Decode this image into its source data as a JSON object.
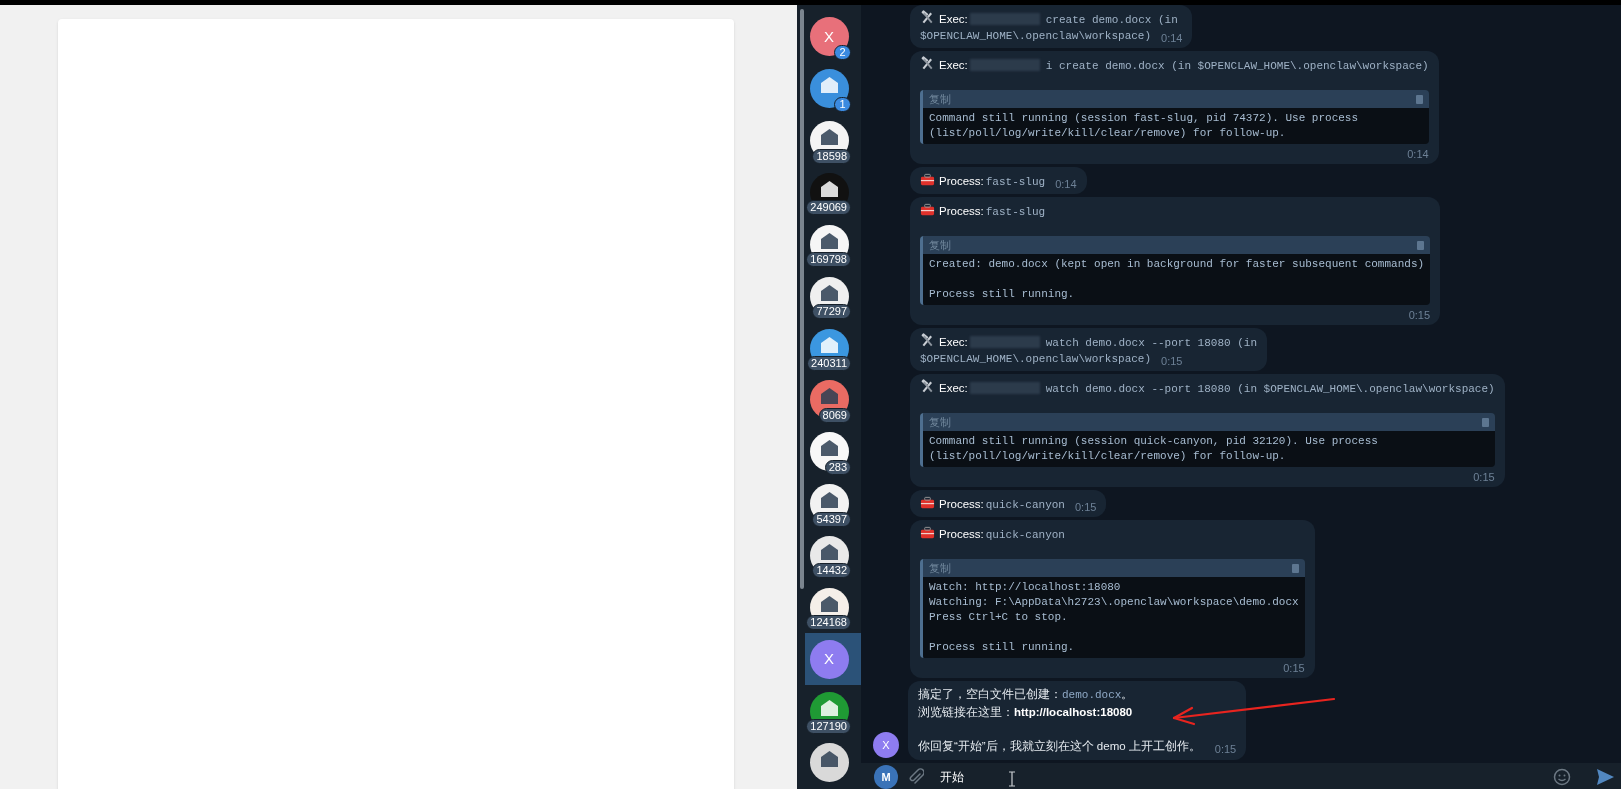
{
  "chats": [
    {
      "kind": "initial",
      "initial": "X",
      "color": "#e8707a",
      "badge": "2",
      "muted": false,
      "selected": false
    },
    {
      "kind": "picture",
      "color": "#3a8fdc",
      "badge": "1",
      "muted": false,
      "selected": false
    },
    {
      "kind": "picture",
      "color": "#f4f4f4",
      "badge": "18598",
      "muted": true,
      "selected": false
    },
    {
      "kind": "picture",
      "color": "#111111",
      "badge": "249069",
      "muted": true,
      "selected": false
    },
    {
      "kind": "picture",
      "color": "#f6f6f6",
      "badge": "169798",
      "muted": true,
      "selected": false
    },
    {
      "kind": "picture",
      "color": "#efefef",
      "badge": "77297",
      "muted": true,
      "selected": false
    },
    {
      "kind": "picture",
      "color": "#3b97e0",
      "badge": "240311",
      "muted": true,
      "selected": false
    },
    {
      "kind": "picture",
      "color": "#ea6b63",
      "badge": "8069",
      "muted": true,
      "selected": false
    },
    {
      "kind": "picture",
      "color": "#f8f8f8",
      "badge": "283",
      "muted": true,
      "selected": false
    },
    {
      "kind": "picture",
      "color": "#f2f2f2",
      "badge": "54397",
      "muted": true,
      "selected": false
    },
    {
      "kind": "picture",
      "color": "#e9e9e9",
      "badge": "14432",
      "muted": true,
      "selected": false
    },
    {
      "kind": "picture",
      "color": "#f5efe9",
      "badge": "124168",
      "muted": true,
      "selected": false
    },
    {
      "kind": "initial",
      "initial": "X",
      "color": "#8e7cf0",
      "selected": true
    },
    {
      "kind": "picture",
      "color": "#1f9a34",
      "badge": "127190",
      "muted": true,
      "selected": false
    },
    {
      "kind": "picture",
      "color": "#d9d9d9",
      "selected": false
    }
  ],
  "messages": [
    {
      "kind": "exec",
      "label": "Exec:",
      "redacted": true,
      "lines": [
        "create demo.docx (in",
        "$OPENCLAW_HOME\\.openclaw\\workspace)"
      ],
      "time": "0:14"
    },
    {
      "kind": "exec",
      "label": "Exec:",
      "redacted": true,
      "lines": [
        "i create demo.docx (in $OPENCLAW_HOME\\.openclaw\\workspace)"
      ],
      "code": {
        "header": "复制",
        "paragraphs": [
          [
            "Command still running (session fast-slug, pid 74372). Use process",
            "(list/poll/log/write/kill/clear/remove) for follow-up."
          ]
        ]
      },
      "time": "0:14"
    },
    {
      "kind": "process",
      "label": "Process:",
      "lines": [
        "fast-slug"
      ],
      "time": "0:14"
    },
    {
      "kind": "process",
      "label": "Process:",
      "lines": [
        "fast-slug"
      ],
      "code": {
        "header": "复制",
        "paragraphs": [
          [
            "Created: demo.docx (kept open in background for faster subsequent commands)"
          ],
          [
            "Process still running."
          ]
        ]
      },
      "time": "0:15"
    },
    {
      "kind": "exec",
      "label": "Exec:",
      "redacted": true,
      "lines": [
        "watch demo.docx --port 18080 (in",
        "$OPENCLAW_HOME\\.openclaw\\workspace)"
      ],
      "time": "0:15"
    },
    {
      "kind": "exec",
      "label": "Exec:",
      "redacted": true,
      "lines": [
        "watch demo.docx --port 18080 (in $OPENCLAW_HOME\\.openclaw\\workspace)"
      ],
      "code": {
        "header": "复制",
        "paragraphs": [
          [
            "Command still running (session quick-canyon, pid 32120). Use process",
            "(list/poll/log/write/kill/clear/remove) for follow-up."
          ]
        ]
      },
      "time": "0:15"
    },
    {
      "kind": "process",
      "label": "Process:",
      "lines": [
        "quick-canyon"
      ],
      "time": "0:15"
    },
    {
      "kind": "process",
      "label": "Process:",
      "lines": [
        "quick-canyon"
      ],
      "code": {
        "header": "复制",
        "paragraphs": [
          [
            "Watch: http://localhost:18080",
            "Watching: F:\\AppData\\h2723\\.openclaw\\workspace\\demo.docx",
            "Press Ctrl+C to stop."
          ],
          [
            "Process still running."
          ]
        ]
      },
      "time": "0:15"
    },
    {
      "kind": "text",
      "sender": {
        "initial": "X",
        "color": "#8e7cf0"
      },
      "paragraphs": [
        [
          [
            {
              "kind": "text",
              "text": "搞定了，空白文件已创建："
            },
            {
              "kind": "code",
              "text": "demo.docx"
            },
            {
              "kind": "text",
              "text": "。"
            }
          ],
          [
            {
              "kind": "text",
              "text": "浏览链接在这里："
            },
            {
              "kind": "bold",
              "text": "http://localhost:18080"
            }
          ]
        ],
        [
          [
            {
              "kind": "text",
              "text": "你回复“开始”后，我就立刻在这个 demo 上开工创作。"
            }
          ]
        ]
      ],
      "time": "0:15"
    }
  ],
  "composer": {
    "avatar_initial": "M",
    "value": "开始"
  }
}
